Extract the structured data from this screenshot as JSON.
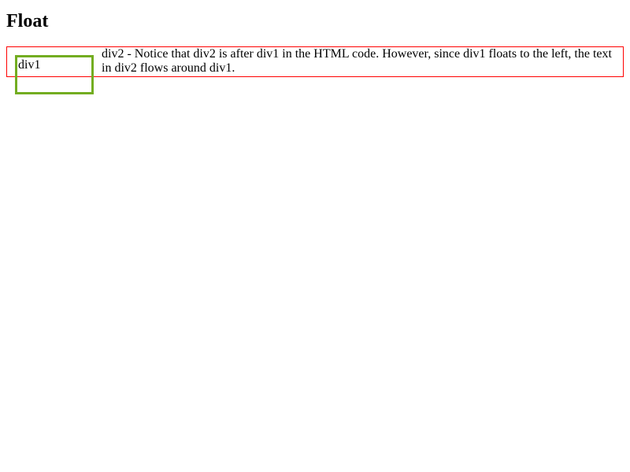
{
  "heading": "Float",
  "div1": {
    "label": "div1"
  },
  "div2": {
    "text": "div2 - Notice that div2 is after div1 in the HTML code. However, since div1 floats to the left, the text in div2 flows around div1."
  }
}
